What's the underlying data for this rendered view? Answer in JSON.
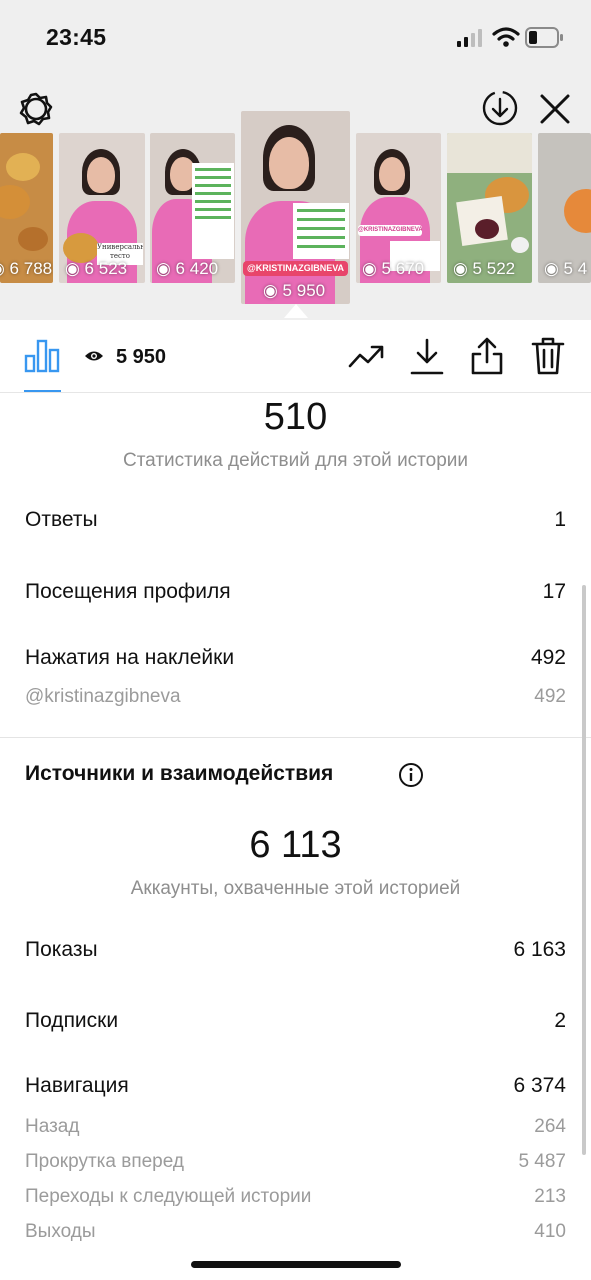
{
  "status_bar": {
    "time": "23:45"
  },
  "stories": [
    {
      "views": "6 788"
    },
    {
      "views": "6 523",
      "caption": "Универсальное тесто"
    },
    {
      "views": "6 420"
    },
    {
      "views": "5 950",
      "tag": "@KRISTINAZGIBNEVA"
    },
    {
      "views": "5 670",
      "tag": "@KRISTINAZGIBNEVA"
    },
    {
      "views": "5 522"
    },
    {
      "views": "5 4"
    }
  ],
  "toolbar": {
    "views": "5 950"
  },
  "actions": {
    "total": "510",
    "caption": "Статистика действий для этой истории",
    "rows": [
      {
        "label": "Ответы",
        "value": "1"
      },
      {
        "label": "Посещения профиля",
        "value": "17"
      },
      {
        "label": "Нажатия на наклейки",
        "value": "492"
      }
    ],
    "sticker_detail": {
      "label": "@kristinazgibneva",
      "value": "492"
    }
  },
  "discovery": {
    "title": "Источники и взаимодействия",
    "total": "6 113",
    "caption": "Аккаунты, охваченные этой историей",
    "rows": [
      {
        "label": "Показы",
        "value": "6 163"
      },
      {
        "label": "Подписки",
        "value": "2"
      },
      {
        "label": "Навигация",
        "value": "6 374"
      }
    ],
    "navigation": [
      {
        "label": "Назад",
        "value": "264"
      },
      {
        "label": "Прокрутка вперед",
        "value": "5 487"
      },
      {
        "label": "Переходы к следующей истории",
        "value": "213"
      },
      {
        "label": "Выходы",
        "value": "410"
      }
    ]
  },
  "colors": {
    "accent": "#3897f0",
    "header_bg": "#efefef",
    "muted": "#8e8e8e"
  }
}
